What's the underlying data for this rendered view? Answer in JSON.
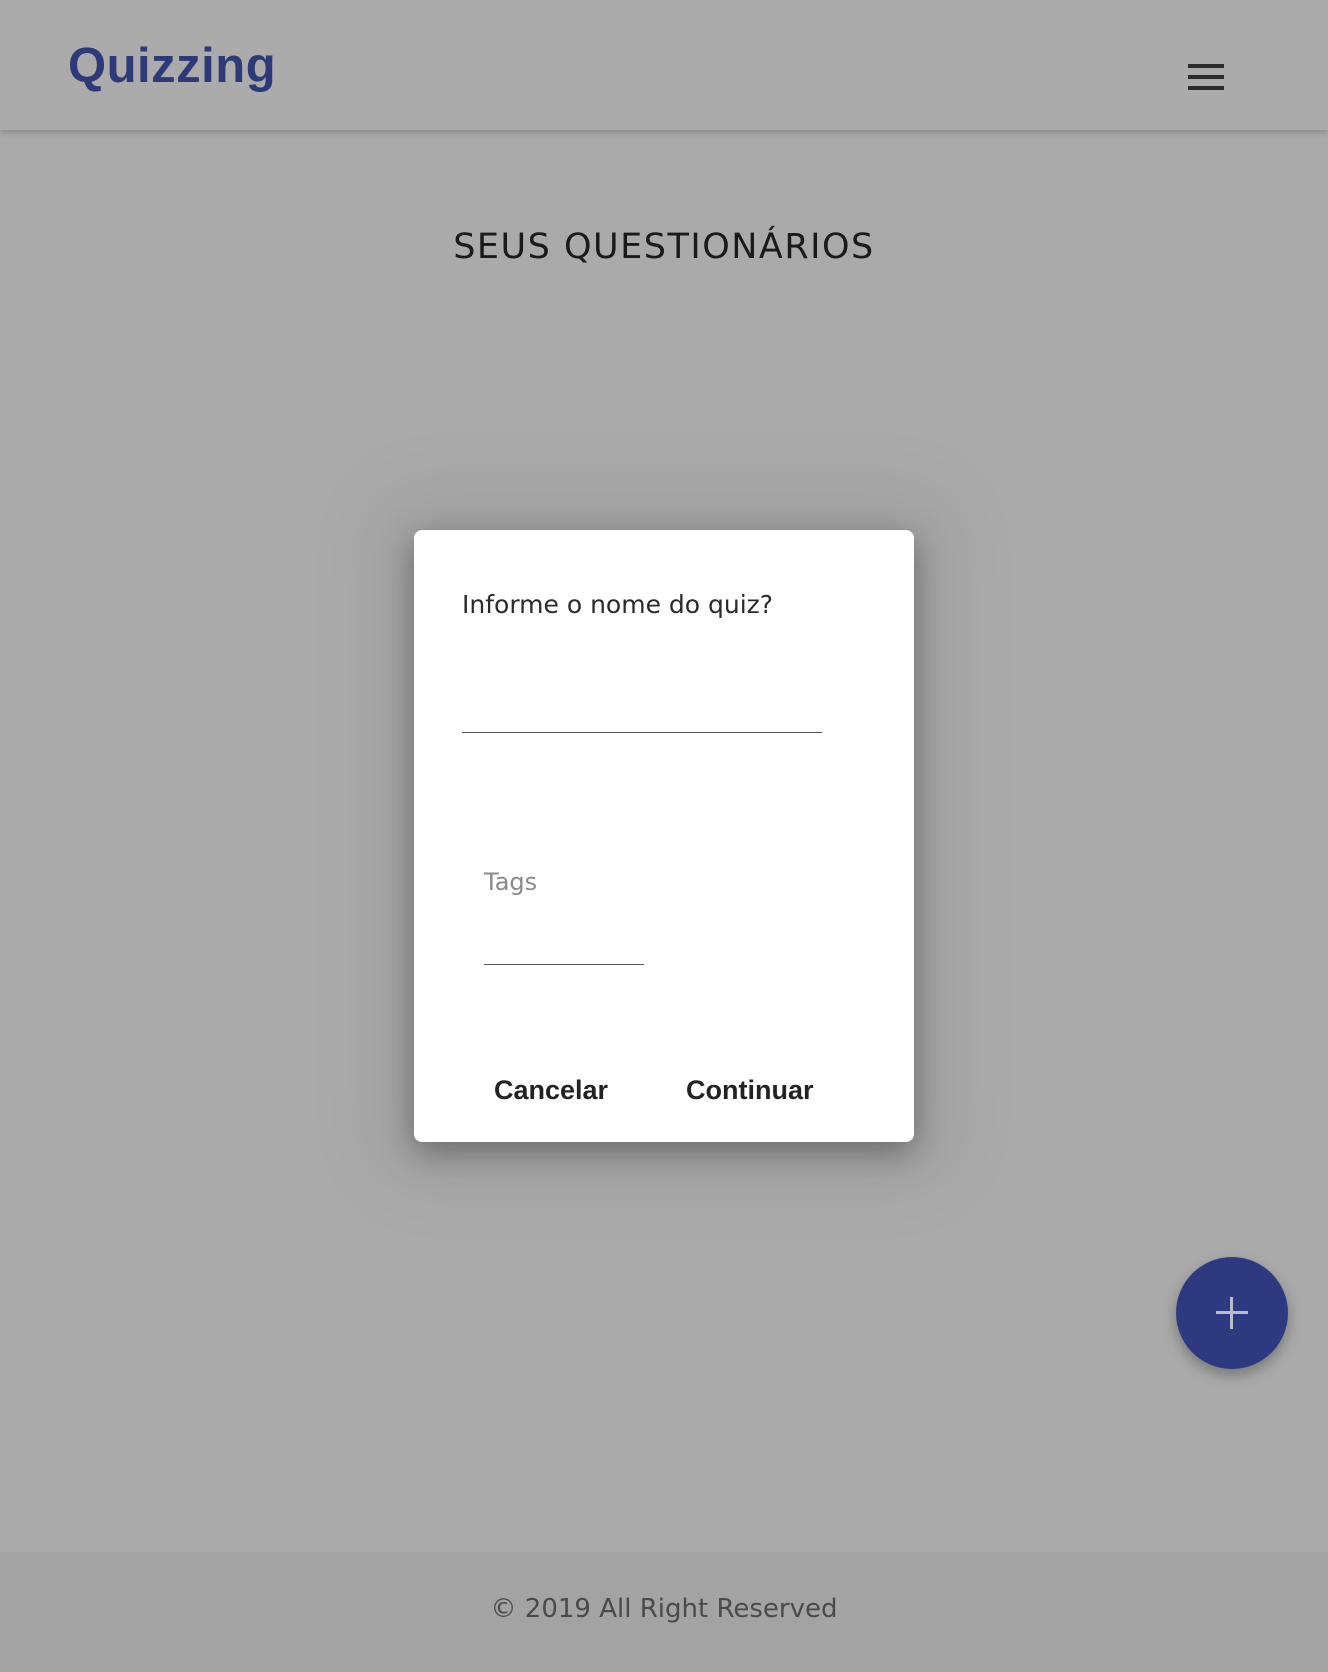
{
  "header": {
    "brand": "Quizzing",
    "menu_icon": "hamburger-menu-icon"
  },
  "main": {
    "title": "SEUS QUESTIONÁRIOS"
  },
  "dialog": {
    "question": "Informe o nome do quiz?",
    "name_value": "",
    "tags_label": "Tags",
    "tags_value": "",
    "cancel_label": "Cancelar",
    "continue_label": "Continuar"
  },
  "fab": {
    "icon": "plus-icon"
  },
  "footer": {
    "text": "© 2019 All Right Reserved"
  },
  "colors": {
    "brand": "#2e3a78",
    "fab": "#2e3a80",
    "overlay_background": "#aaaaaa",
    "dialog_background": "#ffffff"
  }
}
